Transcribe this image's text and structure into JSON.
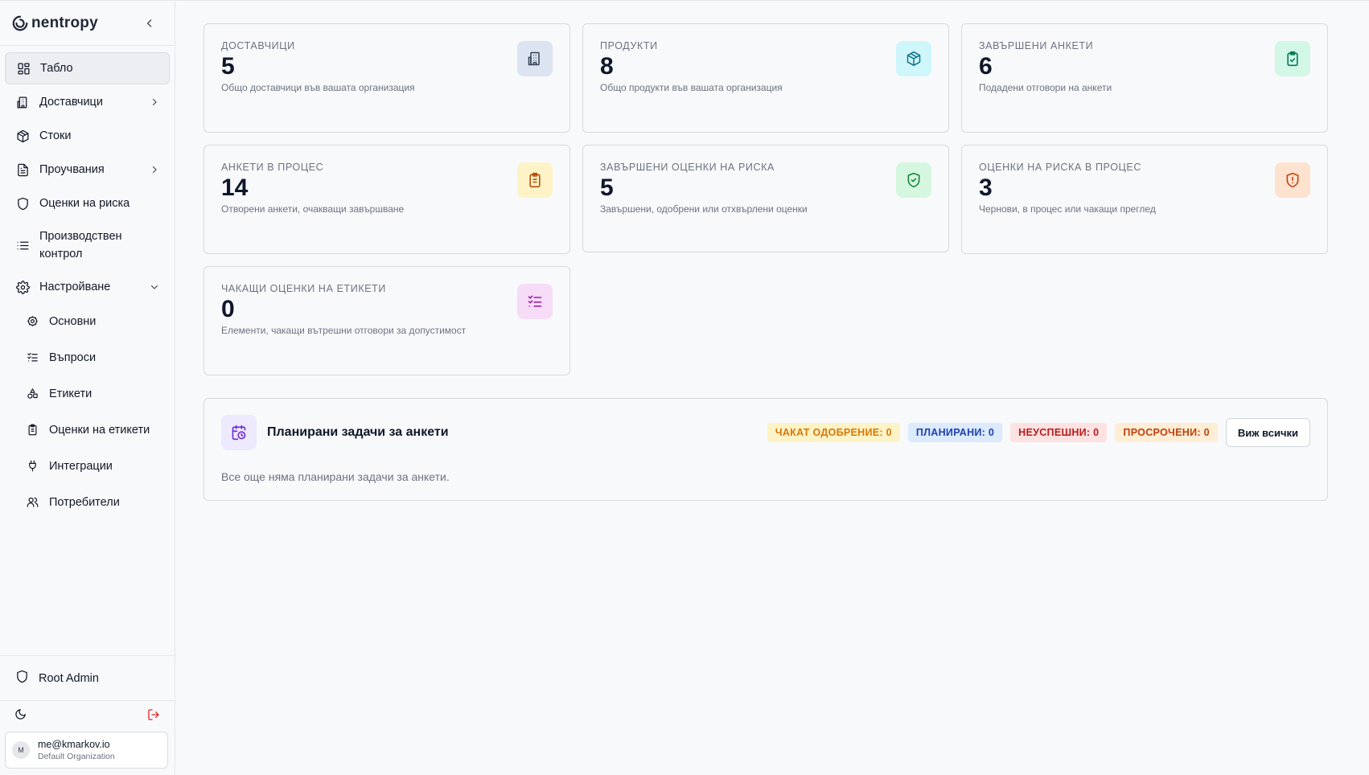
{
  "brand": {
    "name": "nentropy"
  },
  "sidebar": {
    "items": [
      {
        "label": "Табло",
        "icon": "dashboard-icon"
      },
      {
        "label": "Доставчици",
        "icon": "building-icon"
      },
      {
        "label": "Стоки",
        "icon": "package-icon"
      },
      {
        "label": "Проучвания",
        "icon": "document-icon"
      },
      {
        "label": "Оценки на риска",
        "icon": "shield-icon"
      },
      {
        "label": "Производствен контрол",
        "icon": "list-icon"
      },
      {
        "label": "Настройване",
        "icon": "gear-icon"
      }
    ],
    "sub_items": [
      {
        "label": "Основни",
        "icon": "gear-icon"
      },
      {
        "label": "Въпроси",
        "icon": "checklist-icon"
      },
      {
        "label": "Етикети",
        "icon": "shapes-icon"
      },
      {
        "label": "Оценки на етикети",
        "icon": "clipboard-icon"
      },
      {
        "label": "Интеграции",
        "icon": "plug-icon"
      },
      {
        "label": "Потребители",
        "icon": "users-icon"
      }
    ],
    "admin": "Root Admin",
    "user": {
      "initial": "M",
      "email": "me@kmarkov.io",
      "org": "Default Organization"
    }
  },
  "cards": [
    {
      "title": "ДОСТАВЧИЦИ",
      "value": "5",
      "desc": "Общо доставчици във вашата организация",
      "icon": "building-icon",
      "color": "#dbe4f0"
    },
    {
      "title": "ПРОДУКТИ",
      "value": "8",
      "desc": "Общо продукти във вашата организация",
      "icon": "package-icon",
      "color": "#cff6fb"
    },
    {
      "title": "ЗАВЪРШЕНИ АНКЕТИ",
      "value": "6",
      "desc": "Подадени отговори на анкети",
      "icon": "clipboard-check-icon",
      "color": "#d2f7e6"
    },
    {
      "title": "АНКЕТИ В ПРОЦЕС",
      "value": "14",
      "desc": "Отворени анкети, очакващи завършване",
      "icon": "clipboard-icon",
      "color": "#fdf3c7"
    },
    {
      "title": "ЗАВЪРШЕНИ ОЦЕНКИ НА РИСКА",
      "value": "5",
      "desc": "Завършени, одобрени или отхвърлени оценки",
      "icon": "shield-check-icon",
      "color": "#d6f7df"
    },
    {
      "title": "ОЦЕНКИ НА РИСКА В ПРОЦЕС",
      "value": "3",
      "desc": "Чернови, в процес или чакащи преглед",
      "icon": "shield-alert-icon",
      "color": "#fde2cf"
    },
    {
      "title": "ЧАКАЩИ ОЦЕНКИ НА ЕТИКЕТИ",
      "value": "0",
      "desc": "Елементи, чакащи вътрешни отговори за допустимост",
      "icon": "checklist-icon",
      "color": "#f6dcf7"
    }
  ],
  "tasks": {
    "title": "Планирани задачи за анкети",
    "pills": [
      {
        "label": "ЧАКАТ ОДОБРЕНИЕ: 0",
        "bg": "#fef3c7",
        "fg": "#b45309"
      },
      {
        "label": "ПЛАНИРАНИ: 0",
        "bg": "#dbeafe",
        "fg": "#1d4ed8"
      },
      {
        "label": "НЕУСПЕШНИ: 0",
        "bg": "#fee2e2",
        "fg": "#b91c1c"
      },
      {
        "label": "ПРОСРОЧЕНИ: 0",
        "bg": "#ffedd5",
        "fg": "#c2410c"
      }
    ],
    "view_all": "Виж всички",
    "empty": "Все още няма планирани задачи за анкети."
  }
}
